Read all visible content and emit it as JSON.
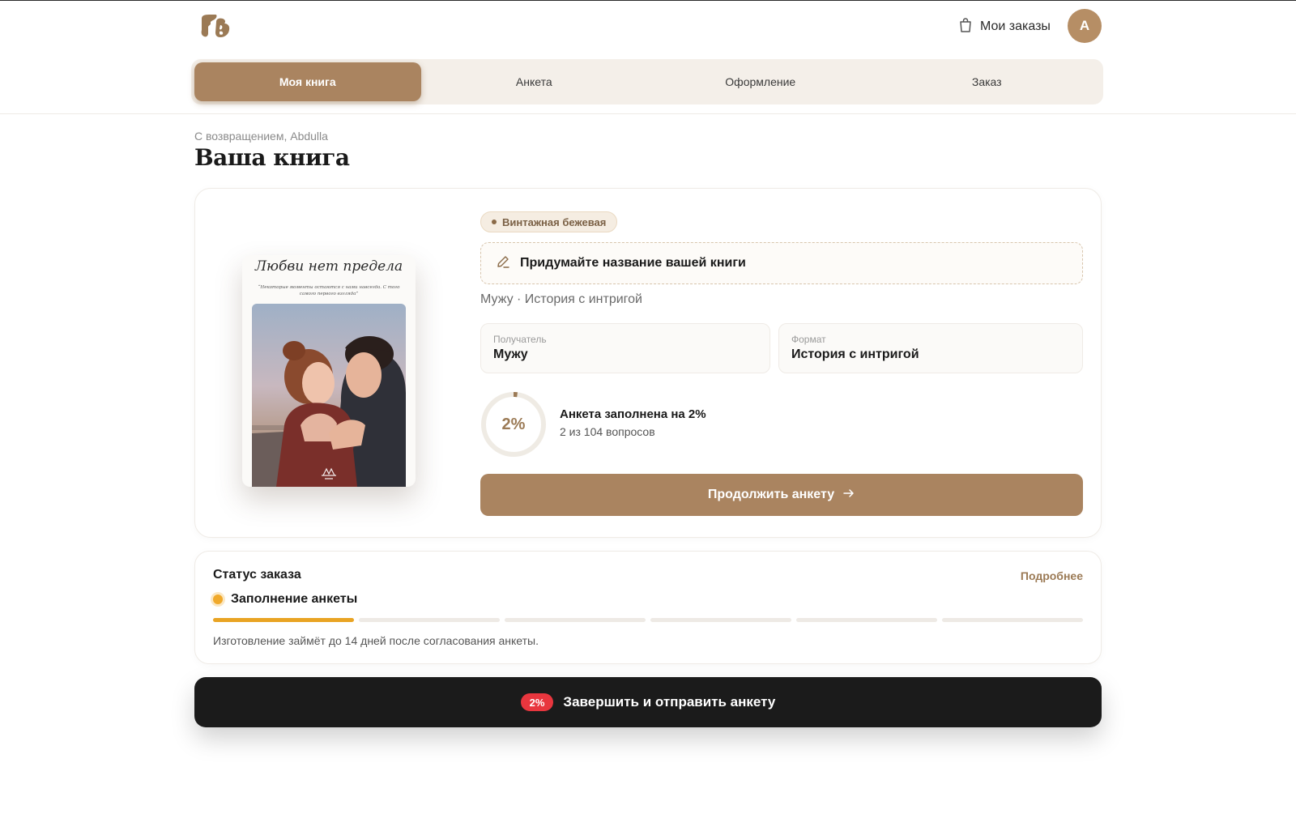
{
  "colors": {
    "accent": "#aa8460",
    "accent_dark": "#9b7a55",
    "tab_bar_bg": "#f4efe9",
    "progress_orange": "#e9a424",
    "pill_red": "#e8363e",
    "dark_button": "#1b1b1b"
  },
  "header": {
    "logo_icon": "brand-logo-icon",
    "orders_icon": "shopping-bag-icon",
    "orders_label": "Мои заказы",
    "avatar_initial": "A"
  },
  "tabs": [
    {
      "label": "Моя книга",
      "active": true
    },
    {
      "label": "Анкета",
      "active": false
    },
    {
      "label": "Оформление",
      "active": false
    },
    {
      "label": "Заказ",
      "active": false
    }
  ],
  "main": {
    "greeting": "С возвращением, Abdulla",
    "title": "Ваша книга"
  },
  "book": {
    "cover_title": "Любви нет предела",
    "cover_subtitle": "“Некоторые моменты остаются с нами навсегда. С того самого первого взгляда”",
    "style_badge": "Винтажная бежевая",
    "title_placeholder": "Придумайте название вашей книги",
    "title_icon": "pencil-icon",
    "meta": "Мужу · История с интригой",
    "recipient_label": "Получатель",
    "recipient_value": "Мужу",
    "format_label": "Формат",
    "format_value": "История с интригой",
    "progress_fraction": 0.02,
    "progress_text": "2%",
    "progress_title": "Анкета заполнена на 2%",
    "progress_sub": "2 из 104 вопросов",
    "continue_label": "Продолжить анкету",
    "continue_icon": "arrow-right-icon"
  },
  "status": {
    "title": "Статус заказа",
    "more_label": "Подробнее",
    "stage": "Заполнение анкеты",
    "steps_total": 6,
    "steps_active": 1,
    "note": "Изготовление займёт до 14 дней после согласования анкеты."
  },
  "submit": {
    "percent": "2%",
    "label": "Завершить и отправить анкету"
  }
}
